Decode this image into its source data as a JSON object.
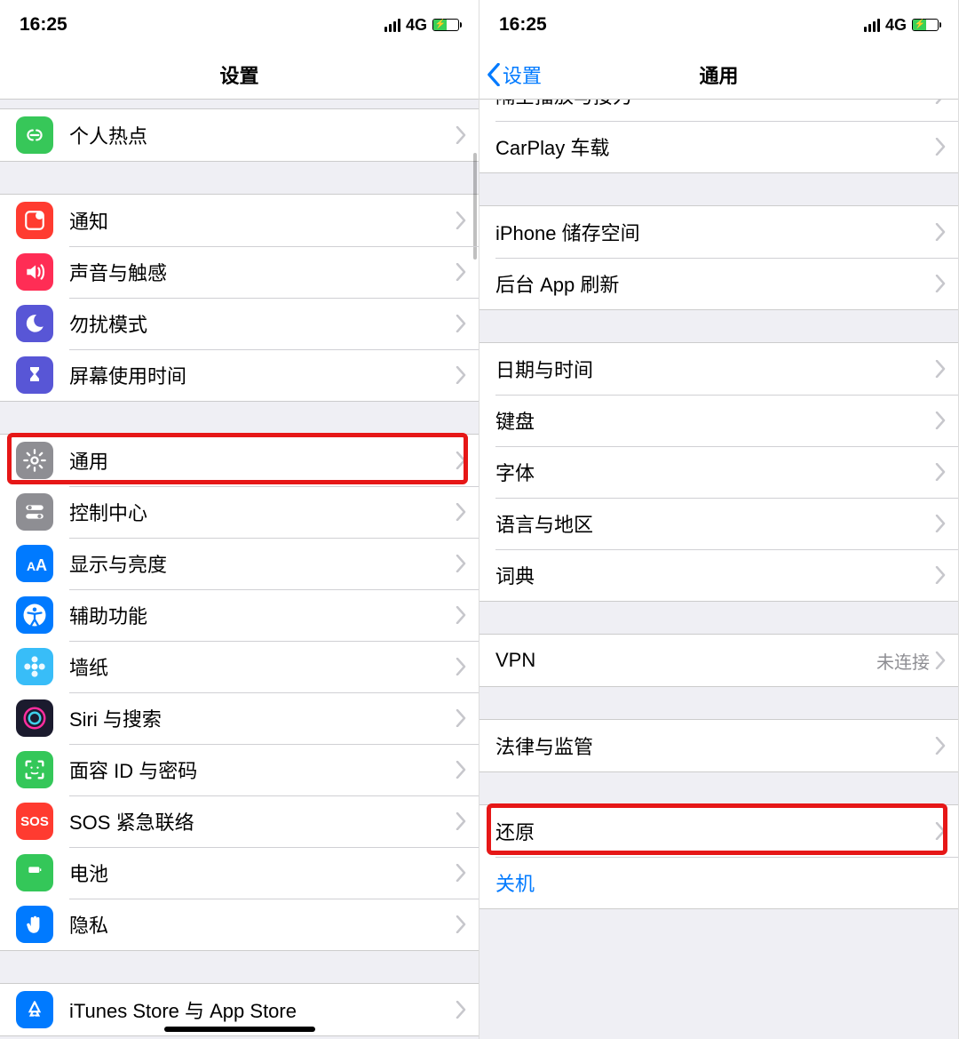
{
  "status": {
    "time": "16:25",
    "network": "4G"
  },
  "left": {
    "title": "设置",
    "groups": [
      {
        "rows": [
          {
            "id": "hotspot",
            "label": "个人热点",
            "icon": "link-icon",
            "bg": "#37c759"
          }
        ]
      },
      {
        "rows": [
          {
            "id": "notifications",
            "label": "通知",
            "icon": "notification-icon",
            "bg": "#ff3b30"
          },
          {
            "id": "sounds",
            "label": "声音与触感",
            "icon": "sound-icon",
            "bg": "#ff2d55"
          },
          {
            "id": "dnd",
            "label": "勿扰模式",
            "icon": "moon-icon",
            "bg": "#5856d6"
          },
          {
            "id": "screentime",
            "label": "屏幕使用时间",
            "icon": "hourglass-icon",
            "bg": "#5856d6"
          }
        ]
      },
      {
        "rows": [
          {
            "id": "general",
            "label": "通用",
            "icon": "gear-icon",
            "bg": "#8e8e93",
            "highlighted": true
          },
          {
            "id": "control-center",
            "label": "控制中心",
            "icon": "toggles-icon",
            "bg": "#8e8e93"
          },
          {
            "id": "display",
            "label": "显示与亮度",
            "icon": "text-size-icon",
            "bg": "#007aff"
          },
          {
            "id": "accessibility",
            "label": "辅助功能",
            "icon": "accessibility-icon",
            "bg": "#007aff"
          },
          {
            "id": "wallpaper",
            "label": "墙纸",
            "icon": "flower-icon",
            "bg": "#38bdf8"
          },
          {
            "id": "siri",
            "label": "Siri 与搜索",
            "icon": "siri-icon",
            "bg": "#1b1b2e"
          },
          {
            "id": "faceid",
            "label": "面容 ID 与密码",
            "icon": "faceid-icon",
            "bg": "#34c759"
          },
          {
            "id": "sos",
            "label": "SOS 紧急联络",
            "icon": "sos-icon",
            "bg": "#ff3b30",
            "text": "SOS"
          },
          {
            "id": "battery",
            "label": "电池",
            "icon": "battery-icon",
            "bg": "#34c759"
          },
          {
            "id": "privacy",
            "label": "隐私",
            "icon": "hand-icon",
            "bg": "#007aff"
          }
        ]
      },
      {
        "rows": [
          {
            "id": "itunes",
            "label": "iTunes Store 与 App Store",
            "icon": "appstore-icon",
            "bg": "#007aff"
          }
        ]
      }
    ]
  },
  "right": {
    "back": "设置",
    "title": "通用",
    "groups": [
      {
        "partial_top": true,
        "rows": [
          {
            "id": "airplay",
            "label": "隔空播放与接力"
          },
          {
            "id": "carplay",
            "label": "CarPlay 车载"
          }
        ]
      },
      {
        "rows": [
          {
            "id": "storage",
            "label": "iPhone 储存空间"
          },
          {
            "id": "background-refresh",
            "label": "后台 App 刷新"
          }
        ]
      },
      {
        "rows": [
          {
            "id": "datetime",
            "label": "日期与时间"
          },
          {
            "id": "keyboard",
            "label": "键盘"
          },
          {
            "id": "fonts",
            "label": "字体"
          },
          {
            "id": "language",
            "label": "语言与地区"
          },
          {
            "id": "dictionary",
            "label": "词典"
          }
        ]
      },
      {
        "rows": [
          {
            "id": "vpn",
            "label": "VPN",
            "value": "未连接"
          }
        ]
      },
      {
        "rows": [
          {
            "id": "legal",
            "label": "法律与监管"
          }
        ]
      },
      {
        "rows": [
          {
            "id": "reset",
            "label": "还原",
            "highlighted": true
          },
          {
            "id": "shutdown",
            "label": "关机",
            "blue": true,
            "no_chev": true
          }
        ]
      }
    ]
  }
}
